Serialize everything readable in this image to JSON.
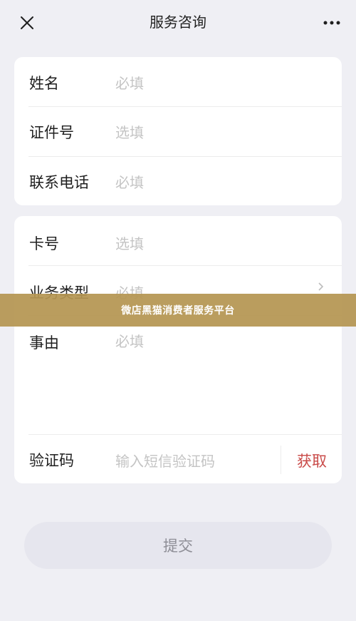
{
  "header": {
    "title": "服务咨询",
    "close_icon": "close-icon",
    "more_icon": "more-dots-icon"
  },
  "form": {
    "name": {
      "label": "姓名",
      "placeholder": "必填"
    },
    "id_number": {
      "label": "证件号",
      "placeholder": "选填"
    },
    "phone": {
      "label": "联系电话",
      "placeholder": "必填"
    },
    "card_number": {
      "label": "卡号",
      "placeholder": "选填"
    },
    "business_type": {
      "label": "业务类型",
      "placeholder": "必填",
      "icon": "chevron-right-icon"
    },
    "reason": {
      "label": "事由",
      "placeholder": "必填"
    },
    "verification_code": {
      "label": "验证码",
      "placeholder": "输入短信验证码",
      "get_code_label": "获取"
    }
  },
  "submit": {
    "label": "提交"
  },
  "watermark": {
    "text": "微店黑猫消费者服务平台"
  },
  "colors": {
    "background": "#efeff4",
    "card": "#ffffff",
    "accent_red": "#c94a48",
    "placeholder": "#c4c4c4",
    "submit_bg": "#e6e6ee",
    "submit_text": "#8e8e96",
    "watermark_bg": "#b59652"
  }
}
